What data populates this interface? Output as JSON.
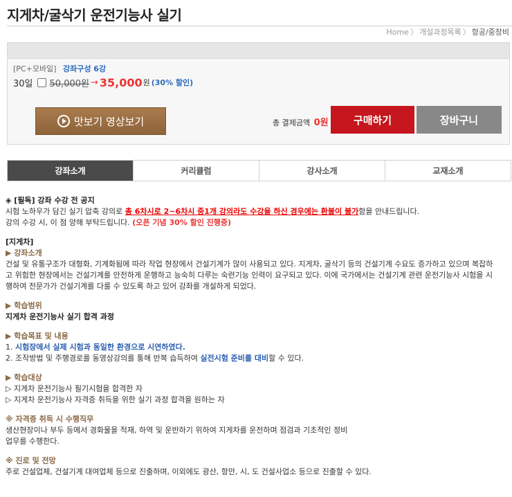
{
  "page_title": "지게차/굴삭기 운전기능사 실기",
  "breadcrumb": {
    "home": "Home",
    "sep1": "〉",
    "category": "개설과정목록",
    "sep2": "〉",
    "current": "항공/중장비"
  },
  "course": {
    "platform": "[PC+모바일]",
    "composition": "강좌구성 6강",
    "duration": "30일",
    "original_price": "50,000원",
    "arrow": "→",
    "sale_price": "35,000",
    "won": "원",
    "discount": "(30% 할인)"
  },
  "actions": {
    "preview_label": "맛보기 영상보기",
    "total_label": "총 결제금액",
    "total_amount": "0원",
    "buy_label": "구매하기",
    "cart_label": "장바구니"
  },
  "tabs": [
    "강좌소개",
    "커리큘럼",
    "강사소개",
    "교재소개"
  ],
  "notice": {
    "title": "◈ [필독] 강좌 수강 전 공지",
    "line1_pre": "시험 노하우가 담긴 실기 압축 강의로 ",
    "line1_red": "총 6차시로 2~6차시 중1개 강의라도 수강을 하신 경우에는 환불이 불가",
    "line1_post": "함을 안내드립니다.",
    "line2_pre": "강의 수강 시, 이 점 양해 부탁드립니다. ",
    "line2_red": "(오픈 기념 30% 할인 진행중)"
  },
  "intro": {
    "category": "[지게차]",
    "heading": "▶ 강좌소개",
    "lines": [
      "건설 및 유통구조가 대형화, 기계화됨에 따라 작업 현장에서 건설기계가 많이 사용되고 있다. 지게차, 굴삭기 등의 건설기계 수요도 증가하고 있으며 복잡하",
      "고 위험한 현장에서는 건설기계를 안전하게 운행하고 능숙히 다루는 숙련기능 인력이 요구되고 있다. 이에 국가에서는 건설기계 관련 운전기능사 시험을 시",
      "행하여 전문가가 건설기계를 다룰 수 있도록 하고 있어 강좌를 개설하게 되었다."
    ]
  },
  "scope": {
    "heading": "▶ 학습범위",
    "text": "지게차 운전기능사 실기 합격 과정"
  },
  "goals": {
    "heading": "▶ 학습목표 및 내용",
    "g1_pre": "1. ",
    "g1_blue": "시험장에서 실제 시험과 동일한 환경으로 시연하였다.",
    "g2_pre": "2. 조작방법 및 주행경로를 동영상강의를 통해 반복 습득하여 ",
    "g2_blue": "실전시험 준비를 대비",
    "g2_post": "할 수 있다."
  },
  "target": {
    "heading": "▶ 학습대상",
    "t1": "▷ 지게차 운전기능사 필기시험을 합격한 자",
    "t2": "▷ 지게차 운전기능사 자격증 취득을 위한 실기 과정 합격을 원하는 자"
  },
  "duties": {
    "heading": "※ 자격증 취득 시 수행직무",
    "l1": "생산현장이나 부두 등에서 경화물을 적재, 하역 및 운반하기 위하여 지게차를 운전하며 점검과 기초적인 정비",
    "l2": "업무를 수행한다."
  },
  "career": {
    "heading": "※ 진로 및 전망",
    "text": "주로 건설업체, 건설기계 대여업체 등으로 진출하며, 이외에도 광산, 항만, 시, 도 건설사업소 등으로 진출할 수 있다."
  }
}
